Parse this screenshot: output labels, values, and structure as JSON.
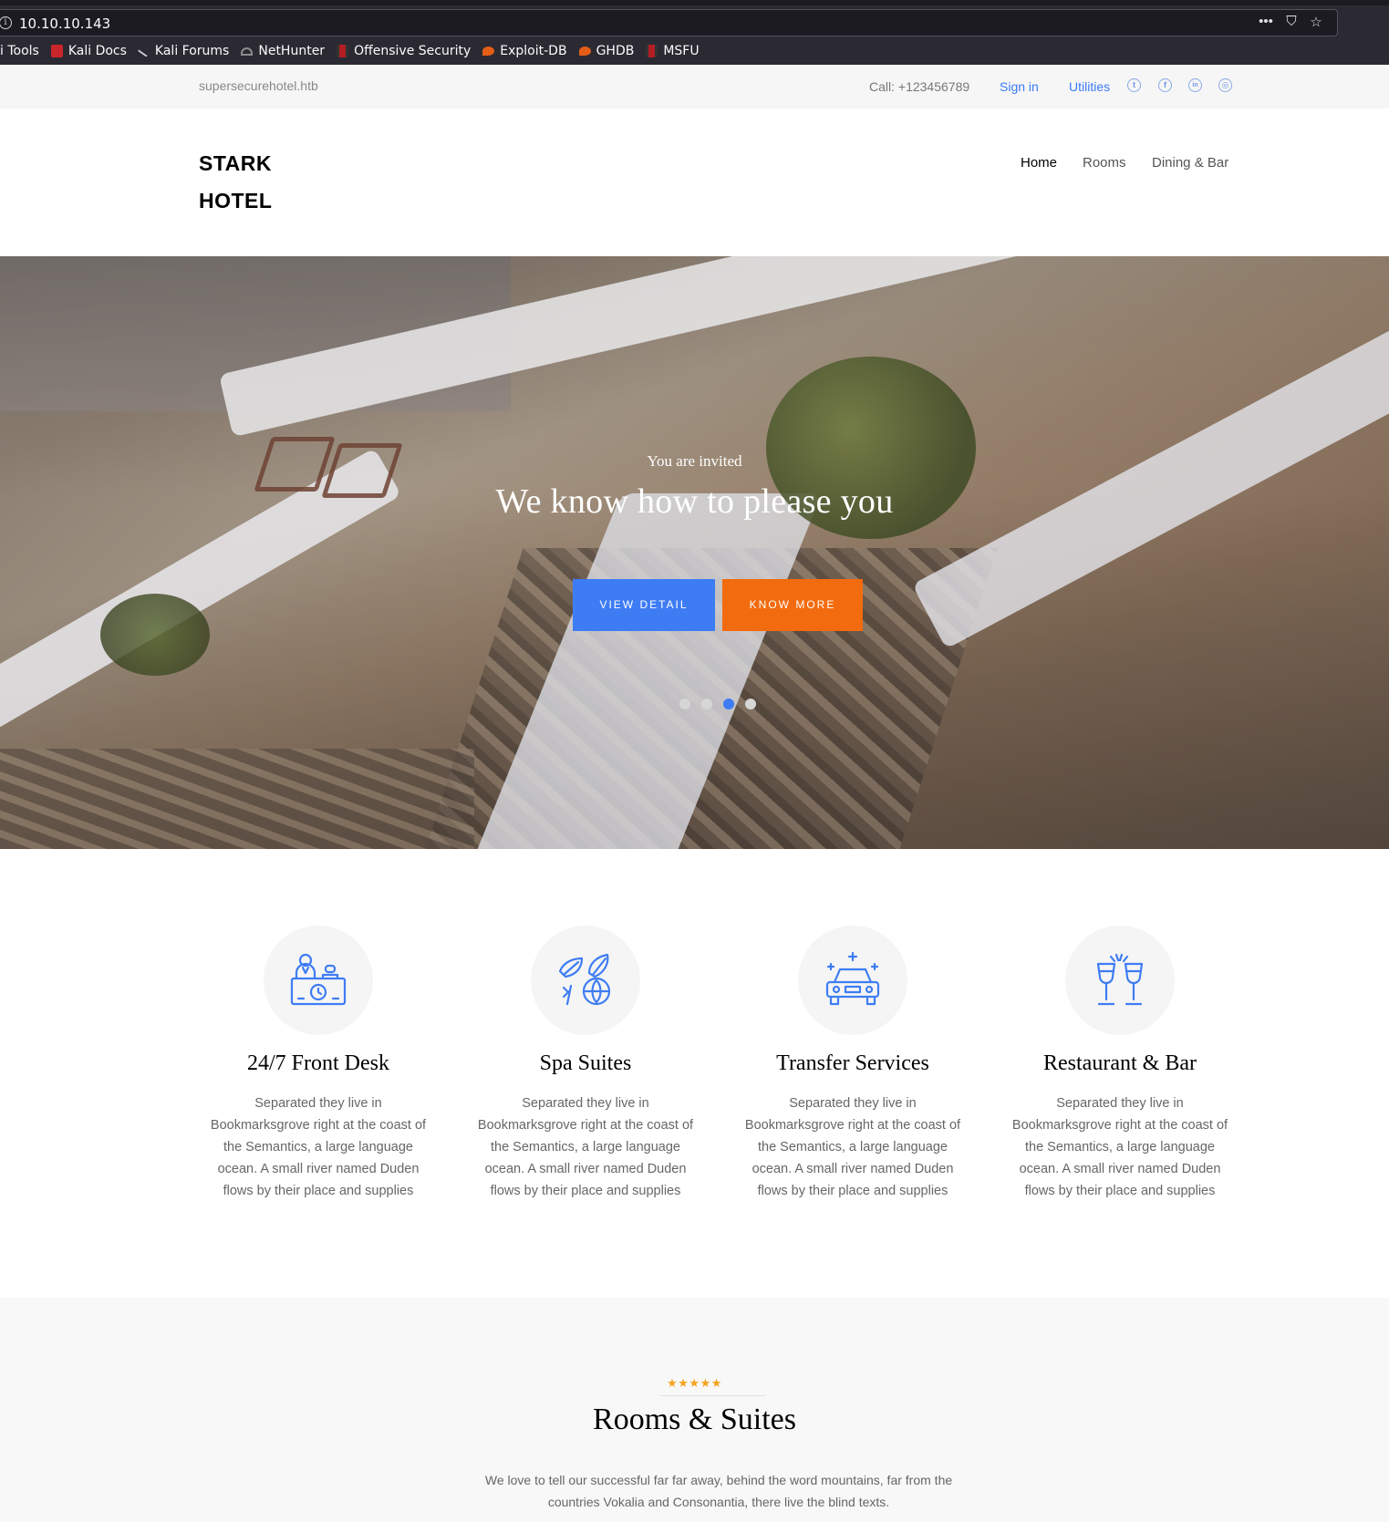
{
  "browser": {
    "url": "10.10.10.143",
    "bookmarks": [
      {
        "label": "i Tools",
        "icon": "none"
      },
      {
        "label": "Kali Docs",
        "icon": "kali-docs-icon"
      },
      {
        "label": "Kali Forums",
        "icon": "kali-dragon-icon"
      },
      {
        "label": "NetHunter",
        "icon": "nethunter-icon"
      },
      {
        "label": "Offensive Security",
        "icon": "offsec-icon"
      },
      {
        "label": "Exploit-DB",
        "icon": "exploit-db-icon"
      },
      {
        "label": "GHDB",
        "icon": "exploit-db-icon"
      },
      {
        "label": "MSFU",
        "icon": "offsec-icon"
      }
    ],
    "controls": {
      "menu": "•••",
      "pocket": "⛉",
      "star": "☆"
    }
  },
  "topbar": {
    "domain": "supersecurehotel.htb",
    "call": "Call: +123456789",
    "signin": "Sign in",
    "utilities": "Utilities",
    "social": [
      {
        "icon": "twitter-icon",
        "glyph": "t"
      },
      {
        "icon": "facebook-icon",
        "glyph": "f"
      },
      {
        "icon": "linkedin-icon",
        "glyph": "in"
      },
      {
        "icon": "dribbble-icon",
        "glyph": "◎"
      }
    ]
  },
  "header": {
    "logo": "STARK HOTEL",
    "nav": [
      "Home",
      "Rooms",
      "Dining & Bar"
    ],
    "active_nav": "Home"
  },
  "hero": {
    "subtitle": "You are invited",
    "title": "We know how to please you",
    "button_primary": "View Detail",
    "button_secondary": "Know More",
    "slides": 4,
    "active_slide": 3
  },
  "services": [
    {
      "title": "24/7 Front Desk",
      "icon": "front-desk-icon",
      "description": "Separated they live in Bookmarksgrove right at the coast of the Semantics, a large language ocean. A small river named Duden flows by their place and supplies"
    },
    {
      "title": "Spa Suites",
      "icon": "spa-leaves-icon",
      "description": "Separated they live in Bookmarksgrove right at the coast of the Semantics, a large language ocean. A small river named Duden flows by their place and supplies"
    },
    {
      "title": "Transfer Services",
      "icon": "car-icon",
      "description": "Separated they live in Bookmarksgrove right at the coast of the Semantics, a large language ocean. A small river named Duden flows by their place and supplies"
    },
    {
      "title": "Restaurant & Bar",
      "icon": "wine-glasses-icon",
      "description": "Separated they live in Bookmarksgrove right at the coast of the Semantics, a large language ocean. A small river named Duden flows by their place and supplies"
    }
  ],
  "rooms": {
    "stars": "★★★★★",
    "title": "Rooms & Suites",
    "description": "We love to tell our successful far far away, behind the word mountains, far from the countries Vokalia and Consonantia, there live the blind texts."
  },
  "colors": {
    "accent_blue": "#3e7cf4",
    "accent_orange": "#f26b0e",
    "star_gold": "#f5a21b",
    "chrome_bg": "#2b2a33"
  }
}
